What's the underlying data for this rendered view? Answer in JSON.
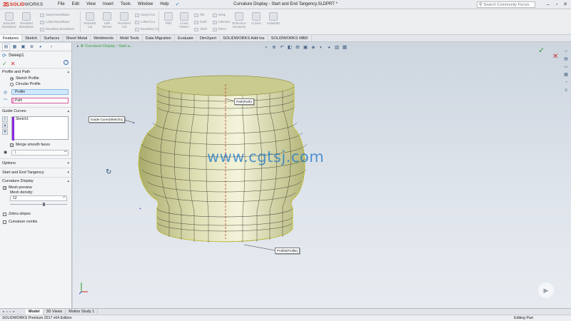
{
  "app": {
    "logo_mark": "3S",
    "logo_name": "SOLID",
    "logo_suffix": "WORKS",
    "menu": [
      "File",
      "Edit",
      "View",
      "Insert",
      "Tools",
      "Window",
      "Help"
    ],
    "document_title": "Curvature Display - Start and End Tangency.SLDPRT *",
    "search_placeholder": "Search Community Forum"
  },
  "ribbon": {
    "items": [
      "Extruded Boss/Base",
      "Revolved Boss/Base",
      "Swept Boss/Base",
      "Lofted Boss/Base",
      "Boundary Boss/Base",
      "Extruded Cut",
      "Hole Wizard",
      "Revolved Cut",
      "Swept Cut",
      "Lofted Cut",
      "Boundary Cut",
      "Fillet",
      "Linear Pattern",
      "Rib",
      "Draft",
      "Shell",
      "Wrap",
      "Intersect",
      "Mirror",
      "Reference Geometry",
      "Curves",
      "Instant3D"
    ]
  },
  "command_tabs": [
    "Features",
    "Sketch",
    "Surfaces",
    "Sheet Metal",
    "Weldments",
    "Mold Tools",
    "Data Migration",
    "Evaluate",
    "DimXpert",
    "SOLIDWORKS Add-Ins",
    "SOLIDWORKS MBD"
  ],
  "property_manager": {
    "title": "Sweep1",
    "profile_path": {
      "header": "Profile and Path",
      "opt_sketch": "Sketch Profile",
      "opt_circular": "Circular Profile",
      "profile_value": "Profile",
      "path_value": "Path"
    },
    "guide_curves": {
      "header": "Guide Curves",
      "items": [
        "Sketch1"
      ],
      "merge_label": "Merge smooth faces",
      "spin_value": "1"
    },
    "options_header": "Options",
    "tangency_header": "Start and End Tangency",
    "curvature": {
      "header": "Curvature Display",
      "mesh_preview": "Mesh preview",
      "mesh_density_label": "Mesh density:",
      "mesh_density_value": "12",
      "mesh_density_fraction": 0.6,
      "zebra": "Zebra stripes",
      "combs": "Curvature combs"
    }
  },
  "viewport": {
    "tree_label": "Curvature Display - Start a...",
    "callouts": {
      "path": "Path(Path)",
      "guide": "Guide Curve(Sketch1)",
      "profile": "Profile(Profile)"
    },
    "watermark": "www.cgtsj.com"
  },
  "bottom_tabs": [
    "Model",
    "3D Views",
    "Motion Study 1"
  ],
  "status": {
    "left": "SOLIDWORKS Premium 2017 x64 Edition",
    "mode": "Editing Part"
  },
  "colors": {
    "accent": "#1f6fc0",
    "ok_green": "#2b9f3a",
    "cancel_red": "#c83333",
    "body_fill": "#cfd09a",
    "edge_yellow": "#e6e233"
  }
}
